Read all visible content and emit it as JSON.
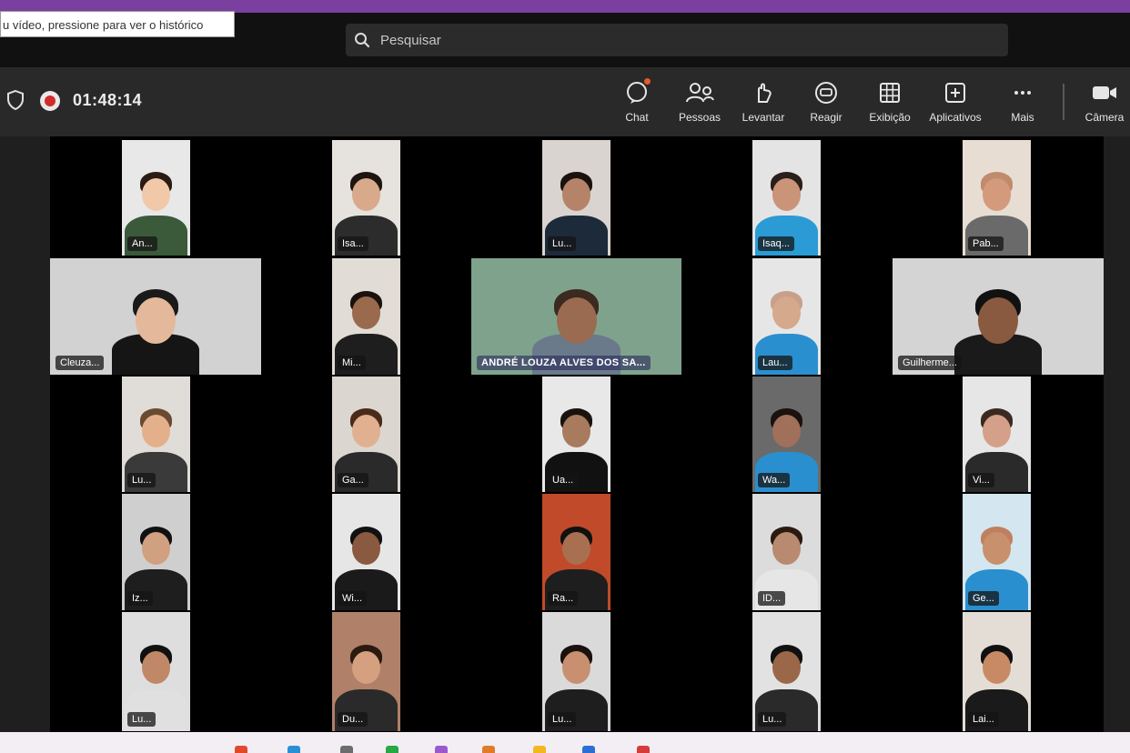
{
  "browser": {
    "accent": "#7b3fa0"
  },
  "tooltip": {
    "text": "u vídeo, pressione para ver o histórico"
  },
  "search": {
    "placeholder": "Pesquisar",
    "icon": "search-icon"
  },
  "meeting": {
    "timer": "01:48:14",
    "recording_icon": "recording-icon",
    "shield_icon": "shield-icon"
  },
  "toolbar": {
    "chat": "Chat",
    "people": "Pessoas",
    "raise": "Levantar",
    "react": "Reagir",
    "view": "Exibição",
    "rooms": "Aplicativos",
    "more": "Mais",
    "camera": "Câmera"
  },
  "participants": [
    {
      "name": "An..."
    },
    {
      "name": "Isa..."
    },
    {
      "name": "Lu..."
    },
    {
      "name": "Isaq..."
    },
    {
      "name": "Pab..."
    },
    {
      "name": "Cleuza..."
    },
    {
      "name": "Mi..."
    },
    {
      "name": "ANDRÉ LOUZA ALVES DOS SA..."
    },
    {
      "name": "Lau..."
    },
    {
      "name": "Guilherme..."
    },
    {
      "name": "Lu..."
    },
    {
      "name": "Ga..."
    },
    {
      "name": "Ua..."
    },
    {
      "name": "Wa..."
    },
    {
      "name": "Vi..."
    },
    {
      "name": "Iz..."
    },
    {
      "name": "Wi..."
    },
    {
      "name": "Ra..."
    },
    {
      "name": "ID..."
    },
    {
      "name": "Ge..."
    },
    {
      "name": "Lu..."
    },
    {
      "name": "Du..."
    },
    {
      "name": "Lu..."
    },
    {
      "name": "Lu..."
    },
    {
      "name": "Lai..."
    }
  ]
}
